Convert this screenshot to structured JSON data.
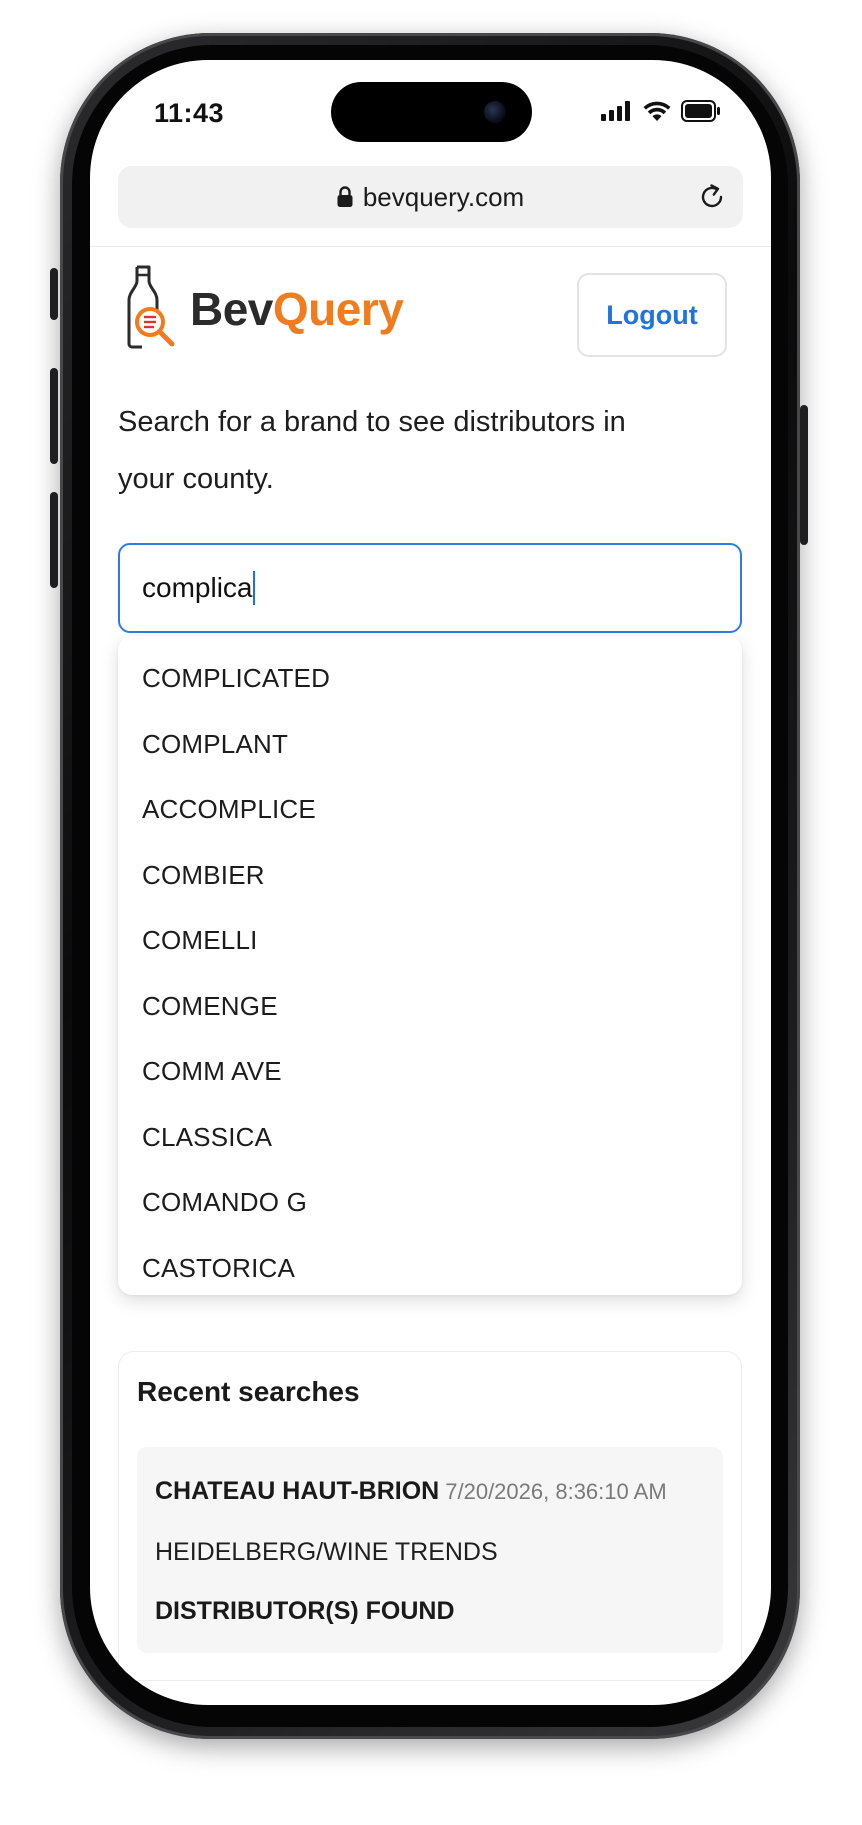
{
  "status_bar": {
    "time": "11:43",
    "icons": [
      "cellular-signal-icon",
      "wifi-icon",
      "battery-icon"
    ]
  },
  "browser": {
    "url": "bevquery.com",
    "lock_icon": "lock-icon",
    "reload_icon": "reload-icon"
  },
  "header": {
    "brand_part1": "Bev",
    "brand_part2": "Query",
    "logo_icon": "bottle-magnifier-icon",
    "logout_label": "Logout"
  },
  "intro": {
    "text": "Search for a brand to see distributors in your county."
  },
  "search": {
    "value": "complica"
  },
  "suggestions": [
    "COMPLICATED",
    "COMPLANT",
    "ACCOMPLICE",
    "COMBIER",
    "COMELLI",
    "COMENGE",
    "COMM AVE",
    "CLASSICA",
    "COMANDO G",
    "CASTORICA"
  ],
  "recent": {
    "title": "Recent searches",
    "items": [
      {
        "brand": "CHATEAU HAUT-BRION",
        "timestamp": "7/20/2026, 8:36:10 AM",
        "distributor": "HEIDELBERG/WINE TRENDS",
        "status": "DISTRIBUTOR(S) FOUND"
      }
    ]
  },
  "colors": {
    "accent_blue": "#1f74e3",
    "brand_orange": "#f07c1e",
    "brand_dark": "#2b2b2b",
    "focus_border": "#2f7be6"
  }
}
